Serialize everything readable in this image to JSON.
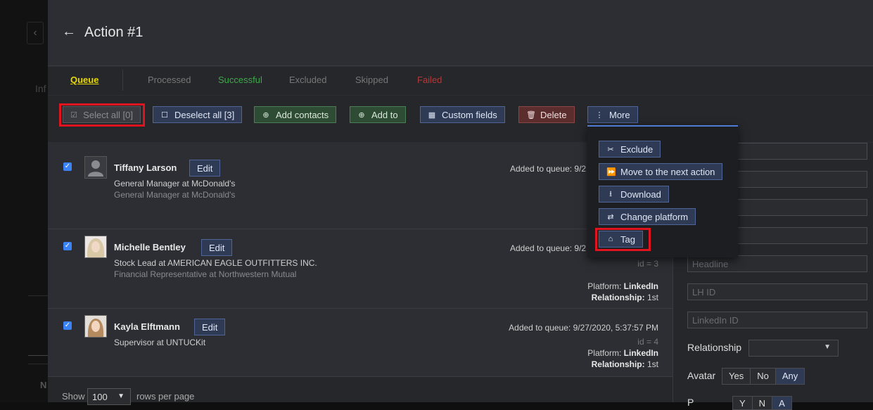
{
  "page": {
    "title": "Action #1",
    "bg_info": "Inf",
    "bg_n": "N"
  },
  "tabs": [
    "Queue",
    "Processed",
    "Successful",
    "Excluded",
    "Skipped",
    "Failed"
  ],
  "toolbar": {
    "select_all": "Select all [0]",
    "deselect_all": "Deselect all [3]",
    "add_contacts": "Add contacts",
    "add_to": "Add to",
    "custom_fields": "Custom fields",
    "delete": "Delete",
    "more": "More"
  },
  "more_menu": [
    "Exclude",
    "Move to the next action",
    "Download",
    "Change platform",
    "Tag"
  ],
  "contacts": [
    {
      "name": "Tiffany Larson",
      "edit": "Edit",
      "line1": "General Manager at McDonald's",
      "line2": "General Manager at McDonald's",
      "added": "Added to queue: 9/2"
    },
    {
      "name": "Michelle Bentley",
      "edit": "Edit",
      "line1": "Stock Lead at AMERICAN EAGLE OUTFITTERS INC.",
      "line2": "Financial Representative at Northwestern Mutual",
      "added": "Added to queue: 9/2",
      "id": "id = 3",
      "platform_label": "Platform:",
      "platform": "LinkedIn",
      "relationship_label": "Relationship:",
      "relationship": "1st"
    },
    {
      "name": "Kayla Elftmann",
      "edit": "Edit",
      "line1": "Supervisor at UNTUCKit",
      "added": "Added to queue: 9/27/2020, 5:37:57 PM",
      "id": "id = 4",
      "platform_label": "Platform:",
      "platform": "LinkedIn",
      "relationship_label": "Relationship:",
      "relationship": "1st"
    }
  ],
  "footer": {
    "show": "Show",
    "rows_value": "100",
    "rows_per_page": "rows per page"
  },
  "filters": {
    "headline_placeholder": "Headline",
    "lhid_placeholder": "LH ID",
    "linkedin_placeholder": "LinkedIn ID",
    "relationship_label": "Relationship",
    "avatar_label": "Avatar",
    "avatar_options": [
      "Yes",
      "No",
      "Any"
    ],
    "avatar_selected": "Any",
    "partial_label": "P",
    "partial_options": [
      "Y",
      "N",
      "A"
    ]
  },
  "colors": {
    "highlight_frame": "#e0141e",
    "queue_tab": "#e8d800",
    "successful_tab": "#3ea84a",
    "failed_tab": "#b03a3a"
  }
}
